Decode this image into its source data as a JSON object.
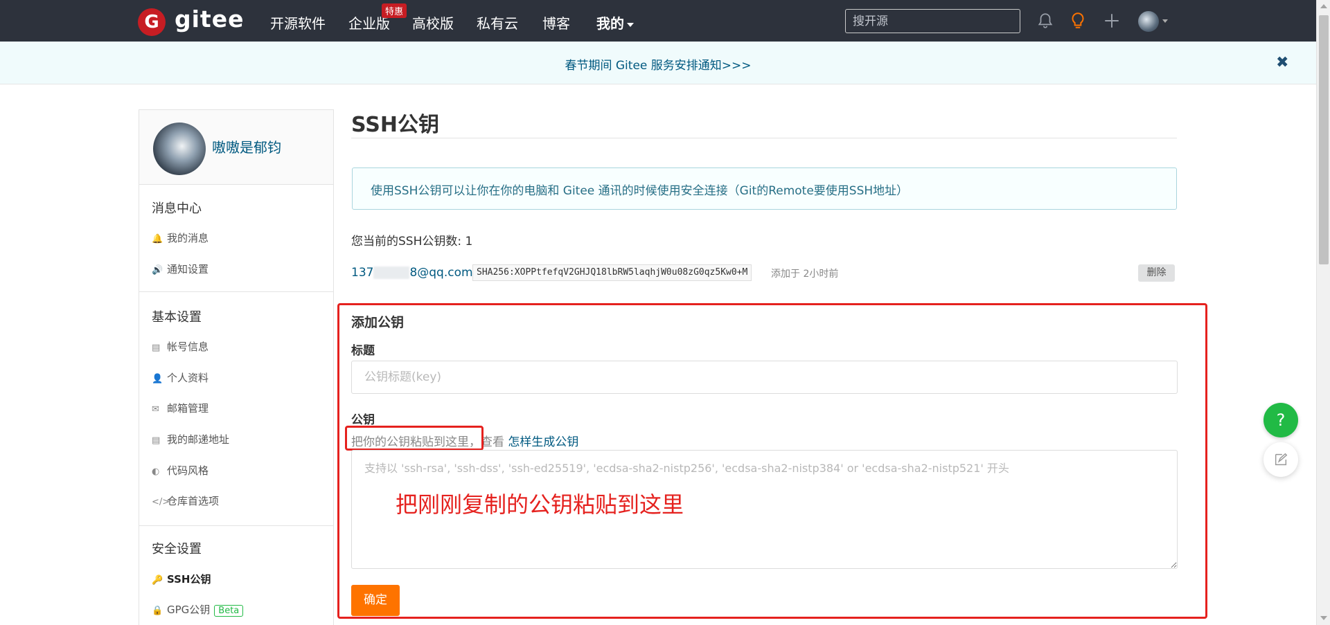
{
  "nav": {
    "logo_letter": "G",
    "logo_text": "gitee",
    "items": [
      "开源软件",
      "企业版",
      "高校版",
      "私有云",
      "博客",
      "我的"
    ],
    "badge": "特惠",
    "search_placeholder": "搜开源"
  },
  "notice": {
    "text": "春节期间 Gitee 服务安排通知>>>",
    "close": "✖"
  },
  "sidebar": {
    "username": "嗷嗷是郁钧",
    "sections": [
      {
        "title": "消息中心",
        "items": [
          {
            "icon": "bell-icon",
            "glyph": "🔔",
            "label": "我的消息"
          },
          {
            "icon": "volume-icon",
            "glyph": "🔊",
            "label": "通知设置"
          }
        ]
      },
      {
        "title": "基本设置",
        "items": [
          {
            "icon": "id-card-icon",
            "glyph": "▤",
            "label": "帐号信息"
          },
          {
            "icon": "user-icon",
            "glyph": "👤",
            "label": "个人资料"
          },
          {
            "icon": "mail-icon",
            "glyph": "✉",
            "label": "邮箱管理"
          },
          {
            "icon": "address-card-icon",
            "glyph": "▤",
            "label": "我的邮递地址"
          },
          {
            "icon": "palette-icon",
            "glyph": "◐",
            "label": "代码风格"
          },
          {
            "icon": "code-icon",
            "glyph": "</>",
            "label": "仓库首选项"
          }
        ]
      },
      {
        "title": "安全设置",
        "items": [
          {
            "icon": "key-icon",
            "glyph": "🔑",
            "label": "SSH公钥"
          },
          {
            "icon": "lock-icon",
            "glyph": "🔒",
            "label": "GPG公钥"
          }
        ]
      }
    ],
    "beta": "Beta"
  },
  "main": {
    "title": "SSH公钥",
    "info": "使用SSH公钥可以让你在你的电脑和 Gitee 通讯的时候使用安全连接（Git的Remote要使用SSH地址）",
    "count_label": "您当前的SSH公钥数: 1",
    "key": {
      "email_prefix": "137",
      "email_suffix": "8@qq.com",
      "fingerprint": "SHA256:XOPPtfefqV2GHJQ18lbRW5laqhjW0u08zG0qz5Kw0+M",
      "added": "添加于 2小时前",
      "delete": "删除"
    },
    "form": {
      "heading": "添加公钥",
      "title_label": "标题",
      "title_placeholder": "公钥标题(key)",
      "key_label": "公钥",
      "hint_prefix": "把你的公钥粘贴到这里，",
      "hint_mid": "查看",
      "hint_link": "怎样生成公钥",
      "key_placeholder": "支持以 'ssh-rsa', 'ssh-dss', 'ssh-ed25519', 'ecdsa-sha2-nistp256', 'ecdsa-sha2-nistp384' or 'ecdsa-sha2-nistp521' 开头",
      "annotation": "把刚刚复制的公钥粘贴到这里",
      "submit": "确定"
    }
  },
  "fab": {
    "help": "?"
  },
  "colors": {
    "nav_bg": "#2d323c",
    "brand_red": "#c71d23",
    "accent_orange": "#fe7300",
    "link": "#005980",
    "annotation_red": "#e5211e",
    "help_green": "#21ba45"
  }
}
